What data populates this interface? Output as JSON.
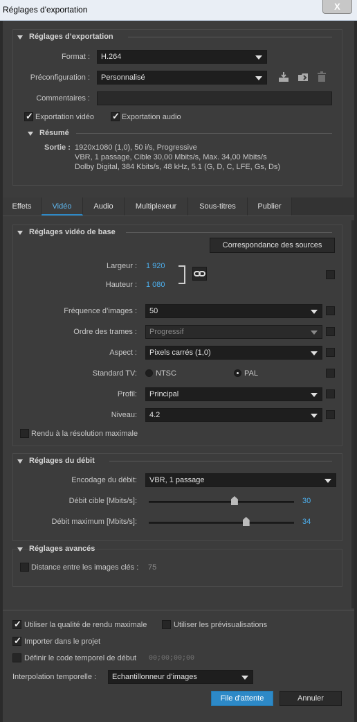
{
  "window": {
    "title": "Réglages d'exportation",
    "close": "X"
  },
  "export": {
    "section_title": "Réglages d’exportation",
    "format_label": "Format :",
    "format_value": "H.264",
    "preset_label": "Préconfiguration :",
    "preset_value": "Personnalisé",
    "comments_label": "Commentaires :",
    "export_video": "Exportation vidéo",
    "export_audio": "Exportation audio",
    "summary_title": "Résumé",
    "output_label": "Sortie :",
    "output_lines": [
      "1920x1080 (1,0), 50 i/s, Progressive",
      "VBR, 1 passage, Cible 30,00  Mbits/s, Max. 34,00  Mbits/s",
      "Dolby Digital, 384  Kbits/s, 48  kHz, 5.1 (G, D, C, LFE, Gs, Ds)"
    ]
  },
  "tabs": [
    "Effets",
    "Vidéo",
    "Audio",
    "Multiplexeur",
    "Sous-titres",
    "Publier"
  ],
  "video": {
    "section_title": "Réglages vidéo de base",
    "match_button": "Correspondance des sources",
    "width_label": "Largeur :",
    "width_value": "1 920",
    "height_label": "Hauteur :",
    "height_value": "1 080",
    "framerate_label": "Fréquence d’images :",
    "framerate_value": "50",
    "field_order_label": "Ordre des trames :",
    "field_order_value": "Progressif",
    "aspect_label": "Aspect :",
    "aspect_value": "Pixels carrés (1,0)",
    "tv_label": "Standard TV:",
    "ntsc": "NTSC",
    "pal": "PAL",
    "profile_label": "Profil:",
    "profile_value": "Principal",
    "level_label": "Niveau:",
    "level_value": "4.2",
    "max_render": "Rendu à la résolution maximale"
  },
  "bitrate": {
    "section_title": "Réglages du débit",
    "encoding_label": "Encodage du débit:",
    "encoding_value": "VBR, 1 passage",
    "target_label": "Débit cible [Mbits/s]:",
    "target_value": "30",
    "target_fraction": 0.59,
    "max_label": "Débit maximum [Mbits/s]:",
    "max_value": "34",
    "max_fraction": 0.67
  },
  "advanced": {
    "section_title": "Réglages avancés",
    "keyframe_label": "Distance entre les images clés :",
    "keyframe_value": "75"
  },
  "footer": {
    "max_quality": "Utiliser la qualité de rendu maximale",
    "use_previews": "Utiliser les prévisualisations",
    "import_project": "Importer dans le projet",
    "timecode": "Définir le code temporel de début",
    "timecode_value": "00;00;00;00",
    "interp_label": "Interpolation temporelle :",
    "interp_value": "Echantillonneur d’images",
    "queue_button": "File d'attente",
    "cancel_button": "Annuler"
  },
  "colors": {
    "accent": "#2d89c7",
    "value_blue": "#4db0ef",
    "background": "#3c3c3c"
  }
}
